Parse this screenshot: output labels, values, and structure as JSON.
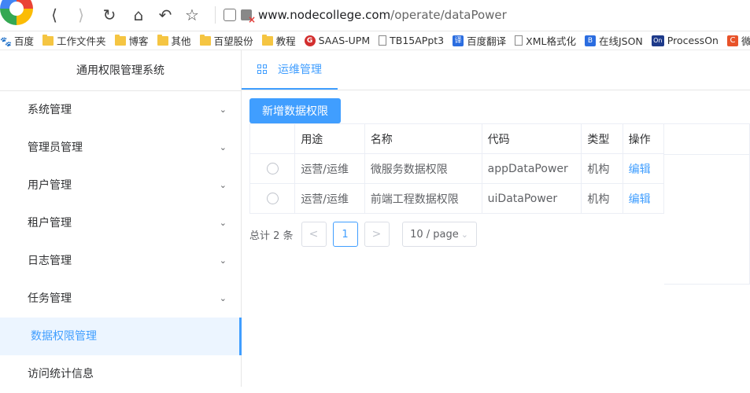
{
  "browser": {
    "url_host": "www.nodecollege.com",
    "url_path": "/operate/dataPower"
  },
  "bookmarks": [
    {
      "icon": "baidu-paw-icon",
      "label": "百度"
    },
    {
      "icon": "folder-icon",
      "label": "工作文件夹"
    },
    {
      "icon": "folder-icon",
      "label": "博客"
    },
    {
      "icon": "folder-icon",
      "label": "其他"
    },
    {
      "icon": "folder-icon",
      "label": "百望股份"
    },
    {
      "icon": "folder-icon",
      "label": "教程"
    },
    {
      "icon": "saas-icon",
      "label": "SAAS-UPM"
    },
    {
      "icon": "doc-icon",
      "label": "TB15APpt3"
    },
    {
      "icon": "translate-icon",
      "label": "百度翻译"
    },
    {
      "icon": "doc-icon",
      "label": "XML格式化"
    },
    {
      "icon": "json-icon",
      "label": "在线JSON"
    },
    {
      "icon": "processon-icon",
      "label": "ProcessOn"
    },
    {
      "icon": "c-icon",
      "label": "微"
    }
  ],
  "sidebar": {
    "title": "通用权限管理系统",
    "items": [
      {
        "label": "系统管理",
        "chevron": "⌄"
      },
      {
        "label": "管理员管理",
        "chevron": "⌄"
      },
      {
        "label": "用户管理",
        "chevron": "⌄"
      },
      {
        "label": "租户管理",
        "chevron": "⌄"
      },
      {
        "label": "日志管理",
        "chevron": "⌄"
      },
      {
        "label": "任务管理",
        "chevron": "⌄"
      },
      {
        "label": "数据权限管理",
        "chevron": ""
      },
      {
        "label": "访问统计信息",
        "chevron": ""
      }
    ]
  },
  "topnav": {
    "tab_label": "运维管理"
  },
  "main": {
    "add_button": "新增数据权限",
    "columns": [
      "",
      "用途",
      "名称",
      "代码",
      "类型",
      "操作"
    ],
    "rows": [
      {
        "usage": "运营/运维",
        "name": "微服务数据权限",
        "code": "appDataPower",
        "type": "机构",
        "action": "编辑"
      },
      {
        "usage": "运营/运维",
        "name": "前端工程数据权限",
        "code": "uiDataPower",
        "type": "机构",
        "action": "编辑"
      }
    ],
    "pager": {
      "total": "总计 2 条",
      "prev": "<",
      "page": "1",
      "next": ">",
      "size": "10 / page"
    }
  },
  "colors": {
    "accent": "#409eff",
    "active_bg": "#ecf5ff"
  }
}
